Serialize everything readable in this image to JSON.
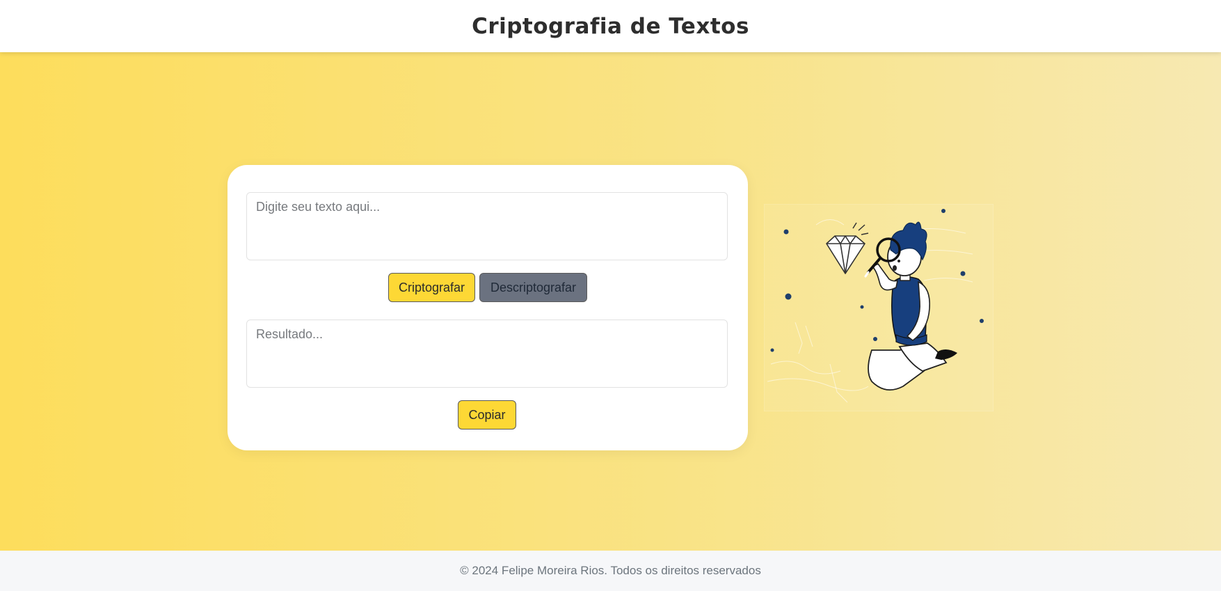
{
  "header": {
    "title": "Criptografia de Textos"
  },
  "card": {
    "input_placeholder": "Digite seu texto aqui...",
    "encrypt_label": "Criptografar",
    "decrypt_label": "Descriptografar",
    "output_placeholder": "Resultado...",
    "copy_label": "Copiar"
  },
  "illustration": {
    "icon": "person-with-magnifier-illustration"
  },
  "footer": {
    "text": "© 2024 Felipe Moreira Rios. Todos os direitos reservados"
  },
  "colors": {
    "accent": "#fdd835",
    "secondary_button": "#6b7280",
    "illustration_blue": "#173f7e",
    "gradient_start": "#fddd5c",
    "gradient_end": "#f7e9b2"
  }
}
